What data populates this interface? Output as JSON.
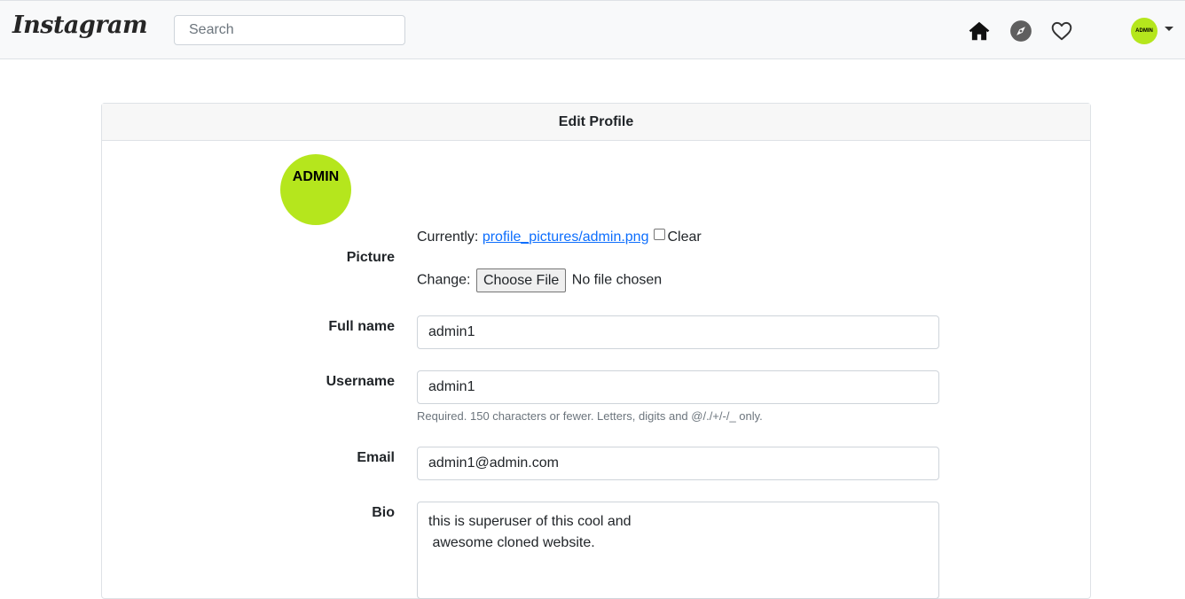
{
  "navbar": {
    "brand": "Instagram",
    "search_placeholder": "Search",
    "icons": [
      "home-icon",
      "compass-icon",
      "heart-icon"
    ],
    "avatar_text": "ADMIN",
    "avatar_color": "#b5e61d"
  },
  "card": {
    "title": "Edit Profile",
    "avatar_text": "ADMIN",
    "avatar_color": "#b5e61d"
  },
  "form": {
    "picture": {
      "label": "Picture",
      "currently_label": "Currently:",
      "current_link": "profile_pictures/admin.png",
      "clear_label": "Clear",
      "change_label": "Change:",
      "choose_file_label": "Choose File",
      "no_file_text": "No file chosen"
    },
    "full_name": {
      "label": "Full name",
      "value": "admin1"
    },
    "username": {
      "label": "Username",
      "value": "admin1",
      "help": "Required. 150 characters or fewer. Letters, digits and @/./+/-/_ only."
    },
    "email": {
      "label": "Email",
      "value": "admin1@admin.com"
    },
    "bio": {
      "label": "Bio",
      "value": "this is superuser of this cool and\n awesome cloned website."
    }
  },
  "colors": {
    "link": "#0d6efd",
    "accent": "#b5e61d"
  }
}
